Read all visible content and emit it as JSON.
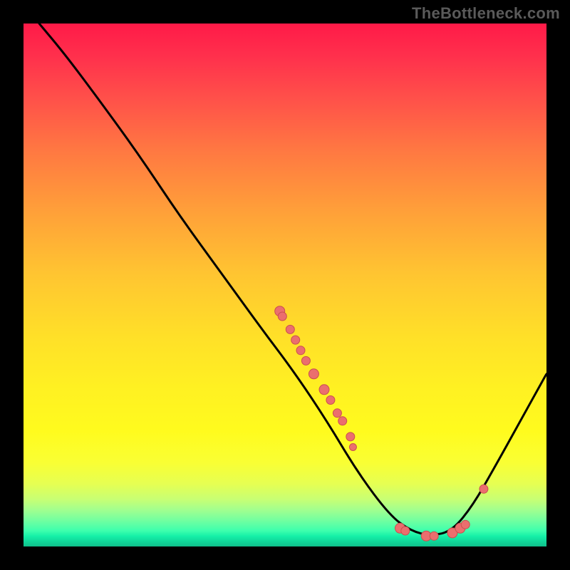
{
  "watermark": "TheBottleneck.com",
  "chart_data": {
    "type": "line",
    "title": "",
    "xlabel": "",
    "ylabel": "",
    "xlim": [
      0,
      100
    ],
    "ylim": [
      0,
      100
    ],
    "curve": [
      {
        "x": 3,
        "y": 100
      },
      {
        "x": 8,
        "y": 94
      },
      {
        "x": 14,
        "y": 86
      },
      {
        "x": 22,
        "y": 75
      },
      {
        "x": 30,
        "y": 63
      },
      {
        "x": 38,
        "y": 52
      },
      {
        "x": 46,
        "y": 41
      },
      {
        "x": 52,
        "y": 33
      },
      {
        "x": 58,
        "y": 24
      },
      {
        "x": 64,
        "y": 14
      },
      {
        "x": 70,
        "y": 6
      },
      {
        "x": 74,
        "y": 3
      },
      {
        "x": 78,
        "y": 2
      },
      {
        "x": 82,
        "y": 3
      },
      {
        "x": 86,
        "y": 8
      },
      {
        "x": 90,
        "y": 15
      },
      {
        "x": 95,
        "y": 24
      },
      {
        "x": 100,
        "y": 33
      }
    ],
    "markers": [
      {
        "x": 49,
        "y": 45,
        "r": 7
      },
      {
        "x": 49.5,
        "y": 44,
        "r": 6
      },
      {
        "x": 51,
        "y": 41.5,
        "r": 6
      },
      {
        "x": 52,
        "y": 39.5,
        "r": 6
      },
      {
        "x": 53,
        "y": 37.5,
        "r": 6
      },
      {
        "x": 54,
        "y": 35.5,
        "r": 6
      },
      {
        "x": 55.5,
        "y": 33,
        "r": 7
      },
      {
        "x": 57.5,
        "y": 30,
        "r": 7
      },
      {
        "x": 58.7,
        "y": 28,
        "r": 6
      },
      {
        "x": 60,
        "y": 25.5,
        "r": 6
      },
      {
        "x": 61,
        "y": 24,
        "r": 6
      },
      {
        "x": 62.5,
        "y": 21,
        "r": 6
      },
      {
        "x": 63,
        "y": 19,
        "r": 5
      },
      {
        "x": 72,
        "y": 3.5,
        "r": 7
      },
      {
        "x": 73,
        "y": 3,
        "r": 6
      },
      {
        "x": 77,
        "y": 2,
        "r": 7
      },
      {
        "x": 78.5,
        "y": 2,
        "r": 6
      },
      {
        "x": 82,
        "y": 2.6,
        "r": 7
      },
      {
        "x": 83.5,
        "y": 3.5,
        "r": 7
      },
      {
        "x": 84.5,
        "y": 4.2,
        "r": 6
      },
      {
        "x": 88,
        "y": 11,
        "r": 6
      }
    ],
    "colors": {
      "curve": "#000000",
      "marker_fill": "#eb6e6e",
      "marker_stroke": "#c94f4f"
    }
  }
}
